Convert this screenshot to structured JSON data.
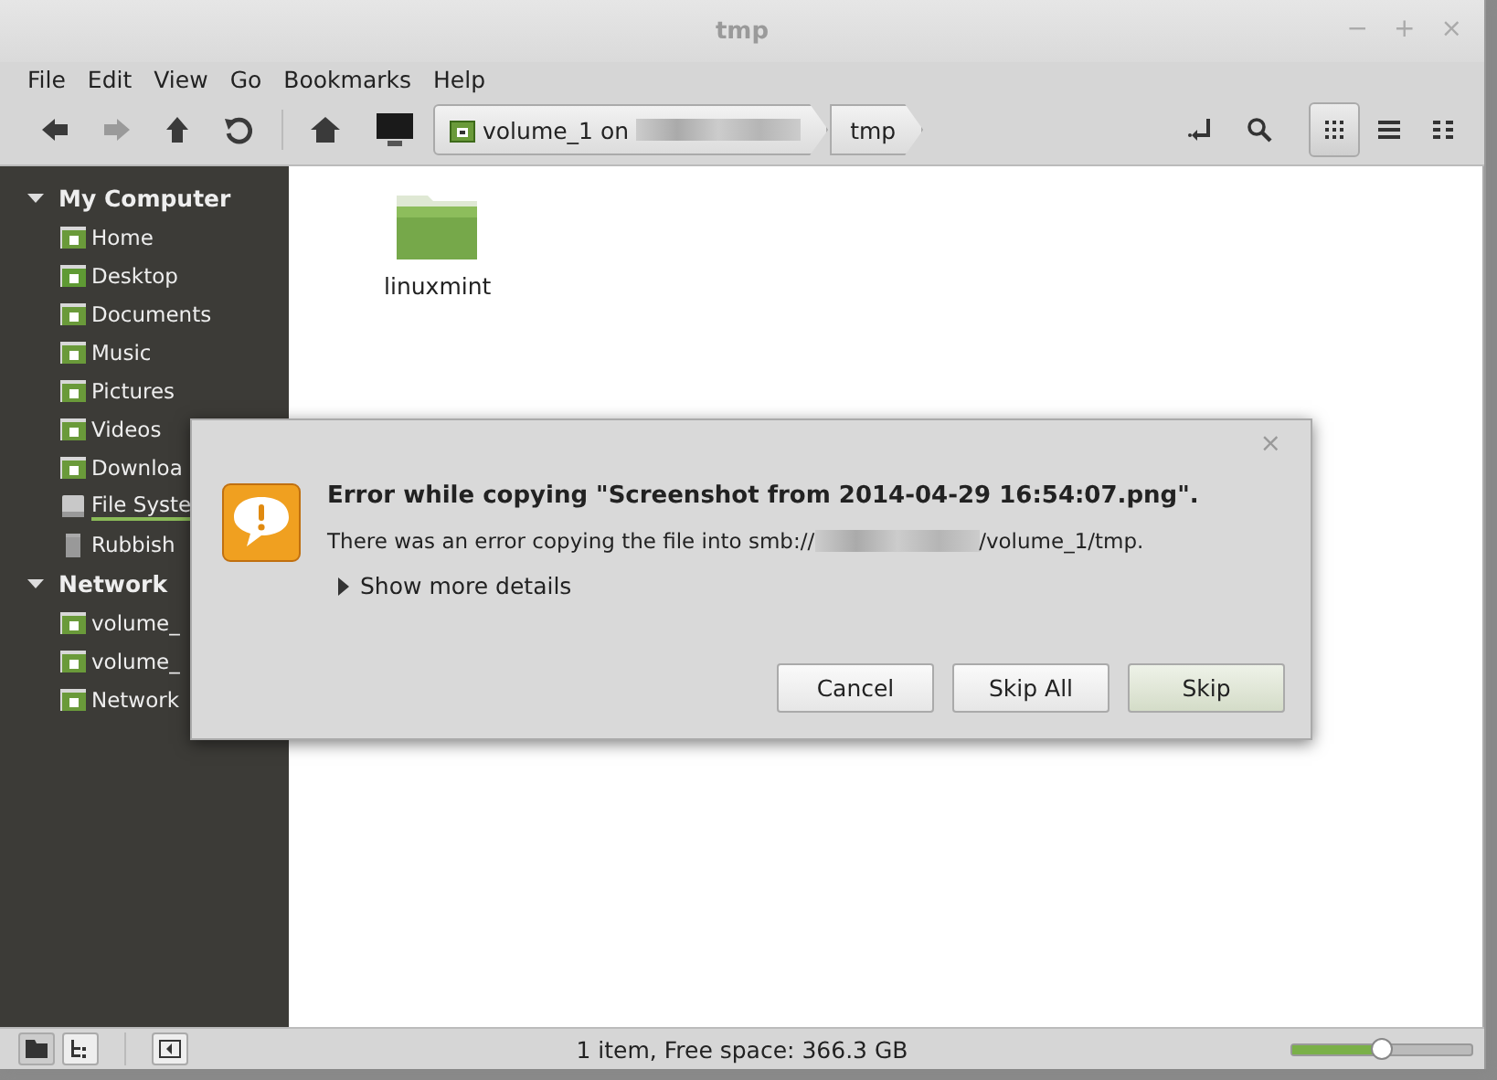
{
  "window": {
    "title": "tmp",
    "controls": [
      "−",
      "+",
      "×"
    ]
  },
  "menu": [
    "File",
    "Edit",
    "View",
    "Go",
    "Bookmarks",
    "Help"
  ],
  "breadcrumb": [
    {
      "label": "volume_1 on",
      "kind": "mount"
    },
    {
      "label": "tmp",
      "kind": "folder"
    }
  ],
  "view_buttons": [
    {
      "kind": "icons",
      "selected": true
    },
    {
      "kind": "list",
      "selected": false
    },
    {
      "kind": "compact",
      "selected": false
    }
  ],
  "sidebar": [
    {
      "label": "My Computer",
      "expanded": true,
      "children": [
        {
          "label": "Home",
          "kind": "home"
        },
        {
          "label": "Desktop",
          "kind": "desktop"
        },
        {
          "label": "Documents",
          "kind": "documents"
        },
        {
          "label": "Music",
          "kind": "music"
        },
        {
          "label": "Pictures",
          "kind": "pictures"
        },
        {
          "label": "Videos",
          "kind": "videos"
        },
        {
          "label": "Downloa",
          "kind": "downloads"
        },
        {
          "label": "File Syste",
          "kind": "drive",
          "level": 0.92
        },
        {
          "label": "Rubbish",
          "kind": "trash"
        }
      ]
    },
    {
      "label": "Network",
      "expanded": true,
      "children": [
        {
          "label": "volume_",
          "kind": "share"
        },
        {
          "label": "volume_",
          "kind": "share"
        },
        {
          "label": "Network",
          "kind": "share"
        }
      ]
    }
  ],
  "files": [
    {
      "name": "linuxmint"
    }
  ],
  "dialog": {
    "title": "Error while copying \"Screenshot from 2014-04-29 16:54:07.png\".",
    "message_start": "There was an error copying the file into smb://",
    "message_end": "/volume_1/tmp.",
    "details": "Show more details",
    "close": "×",
    "buttons": [
      {
        "label": "Cancel",
        "default": false
      },
      {
        "label": "Skip All",
        "default": false
      },
      {
        "label": "Skip",
        "default": true
      }
    ]
  },
  "status_bar": {
    "text": "1 item, Free space: 366.3 GB",
    "zoom": {
      "level": 0.5
    }
  }
}
